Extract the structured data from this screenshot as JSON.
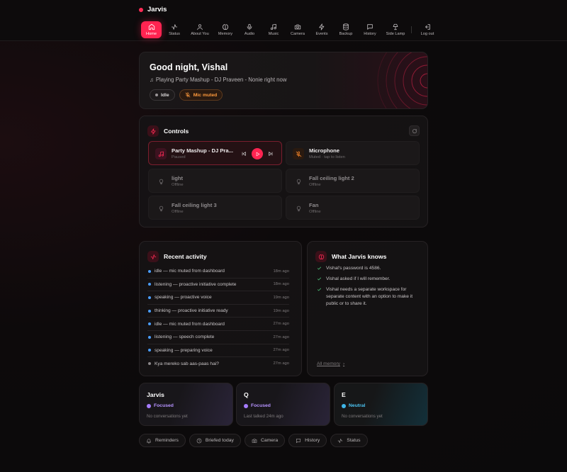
{
  "app": {
    "name": "Jarvis",
    "accent": "#ff2451"
  },
  "nav": [
    {
      "label": "Home",
      "icon": "home-icon",
      "active": true
    },
    {
      "label": "Status",
      "icon": "pulse-icon"
    },
    {
      "label": "About You",
      "icon": "user-icon"
    },
    {
      "label": "Memory",
      "icon": "brain-icon"
    },
    {
      "label": "Audio",
      "icon": "mic-icon"
    },
    {
      "label": "Music",
      "icon": "music-icon"
    },
    {
      "label": "Camera",
      "icon": "camera-icon"
    },
    {
      "label": "Events",
      "icon": "bolt-icon"
    },
    {
      "label": "Backup",
      "icon": "database-icon"
    },
    {
      "label": "History",
      "icon": "chat-icon"
    },
    {
      "label": "Side Lamp",
      "icon": "lamp-icon"
    },
    {
      "label": "Log out",
      "icon": "logout-icon"
    }
  ],
  "hero": {
    "title": "Good night, Vishal",
    "playing": "Playing Party Mashup - DJ Praveen - Nonie right now",
    "status_badge": "Idle",
    "mic_badge": "Mic muted"
  },
  "controls": {
    "title": "Controls",
    "now_playing": {
      "name": "Party Mashup - DJ Pra...",
      "state": "Paused"
    },
    "microphone": {
      "name": "Microphone",
      "state": "Muted · tap to listen"
    },
    "devices": [
      {
        "name": "light",
        "state": "Offline"
      },
      {
        "name": "Fall ceiling light 2",
        "state": "Offline"
      },
      {
        "name": "Fall ceiling light 3",
        "state": "Offline"
      },
      {
        "name": "Fan",
        "state": "Offline"
      }
    ]
  },
  "activity": {
    "title": "Recent activity",
    "items": [
      {
        "text": "idle — mic muted from dashboard",
        "time": "18m ago",
        "color": "#4a9eff"
      },
      {
        "text": "listening — proactive initiative complete",
        "time": "18m ago",
        "color": "#4a9eff"
      },
      {
        "text": "speaking — proactive voice",
        "time": "19m ago",
        "color": "#4a9eff"
      },
      {
        "text": "thinking — proactive initiative ready",
        "time": "19m ago",
        "color": "#4a9eff"
      },
      {
        "text": "idle — mic muted from dashboard",
        "time": "27m ago",
        "color": "#4a9eff"
      },
      {
        "text": "listening — speech complete",
        "time": "27m ago",
        "color": "#4a9eff"
      },
      {
        "text": "speaking — preparing voice",
        "time": "27m ago",
        "color": "#4a9eff"
      },
      {
        "text": "Kya mereko sab aas-paas hai?",
        "time": "27m ago",
        "color": "#8a8688"
      }
    ]
  },
  "knows": {
    "title": "What Jarvis knows",
    "items": [
      "Vishal's password is 4586.",
      "Vishal asked if I will remember.",
      "Vishal needs a separate workspace for separate content with an option to make it public or to share it."
    ],
    "all_link": "All memory"
  },
  "personas": [
    {
      "name": "Jarvis",
      "mood": "Focused",
      "mood_color": "#a67cff",
      "sub": "No conversations yet"
    },
    {
      "name": "Q",
      "mood": "Focused",
      "mood_color": "#a67cff",
      "sub": "Last talked 24m ago"
    },
    {
      "name": "E",
      "mood": "Neutral",
      "mood_color": "#3fb6e8",
      "sub": "No conversations yet"
    }
  ],
  "chips": [
    {
      "label": "Reminders",
      "icon": "bell-icon"
    },
    {
      "label": "Briefed today",
      "icon": "clock-icon"
    },
    {
      "label": "Camera",
      "icon": "camera-icon"
    },
    {
      "label": "History",
      "icon": "chat-icon"
    },
    {
      "label": "Status",
      "icon": "pulse-icon"
    }
  ]
}
